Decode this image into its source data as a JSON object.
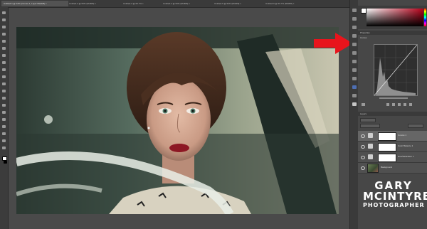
{
  "window": {
    "document_tabs": [
      "Untitled-1 @ 12% (Curves 1, Layer Mask/8) ×",
      "Untitled-2 @ 50% (RGB/8) ×",
      "Untitled-3 @ 66.7% ×",
      "Untitled-4 @ 50% (RGB/8) ×",
      "Untitled-5 @ 50% (RGB/8) ×",
      "Untitled-6 @ 66.7% (RGB/8) ×"
    ]
  },
  "color_panel": {
    "foreground": "#ffffff",
    "hue": "#b8001a"
  },
  "properties_panel": {
    "title": "Properties",
    "adjustment": "Curves"
  },
  "layers_panel": {
    "title": "Layers",
    "layers": [
      {
        "name": "Curves 1",
        "selected": true,
        "kind": "adjustment"
      },
      {
        "name": "Color Balance 1",
        "selected": false,
        "kind": "adjustment"
      },
      {
        "name": "Hue/Saturation 1",
        "selected": false,
        "kind": "adjustment"
      },
      {
        "name": "Background",
        "selected": false,
        "kind": "image"
      }
    ]
  },
  "watermark": {
    "line1": "GARY",
    "line2": "MCINTYRE",
    "line3": "PHOTOGRAPHER"
  },
  "annotation": {
    "arrow_color": "#e8141c"
  },
  "canvas": {
    "image": "portrait-woman-in-vintage-car"
  }
}
